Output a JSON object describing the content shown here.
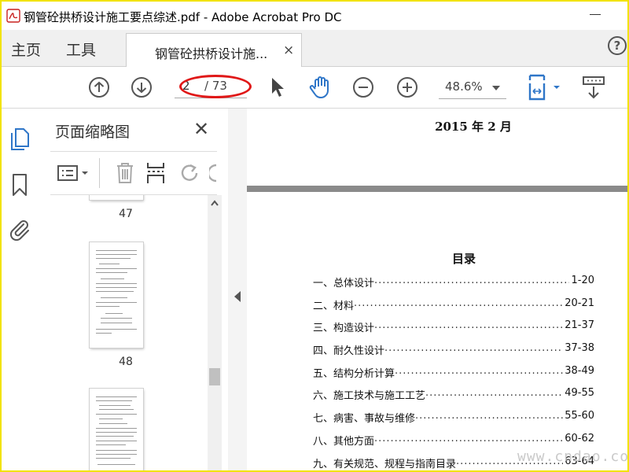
{
  "window": {
    "title": "钢管砼拱桥设计施工要点综述.pdf - Adobe Acrobat Pro DC"
  },
  "tabs": {
    "home": "主页",
    "tools": "工具",
    "document": "钢管砼拱桥设计施...",
    "document_close": "×"
  },
  "toolbar": {
    "current_page": "2",
    "total_pages": "/ 73",
    "zoom": "48.6%"
  },
  "sidebar": {
    "panel_title": "页面缩略图",
    "thumbnails": [
      {
        "label": "47"
      },
      {
        "label": "48"
      }
    ]
  },
  "document": {
    "date_line": "2015 年 2 月",
    "toc_title": "目录",
    "toc": [
      {
        "label": "一、总体设计",
        "pages": "1-20"
      },
      {
        "label": "二、材料",
        "pages": "20-21"
      },
      {
        "label": "三、构造设计",
        "pages": "21-37"
      },
      {
        "label": "四、耐久性设计",
        "pages": "37-38"
      },
      {
        "label": "五、结构分析计算",
        "pages": "38-49"
      },
      {
        "label": "六、施工技术与施工工艺",
        "pages": "49-55"
      },
      {
        "label": "七、病害、事故与维修",
        "pages": "55-60"
      },
      {
        "label": "八、其他方面",
        "pages": "60-62"
      },
      {
        "label": "九、有关规范、规程与指南目录",
        "pages": "63-64"
      }
    ]
  },
  "watermark": "www.cndao.com",
  "colors": {
    "accent_blue": "#2f76c8",
    "annotation_red": "#e01818",
    "frame_yellow": "#f2e300"
  },
  "icons": [
    "acrobat-icon",
    "help-icon",
    "arrow-up-circle-icon",
    "arrow-down-circle-icon",
    "cursor-icon",
    "hand-icon",
    "zoom-out-icon",
    "zoom-in-icon",
    "page-fit-icon",
    "read-mode-icon",
    "pages-icon",
    "bookmark-icon",
    "attachment-icon",
    "options-icon",
    "trash-icon",
    "insert-page-icon",
    "rotate-icon"
  ]
}
